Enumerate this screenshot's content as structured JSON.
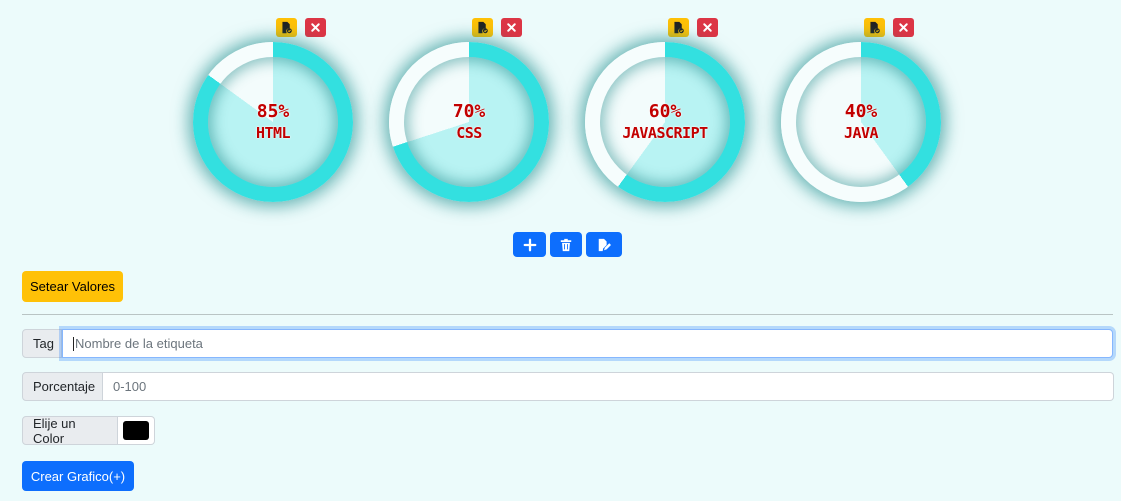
{
  "colors": {
    "ring_fill": "#33e0e0",
    "ring_empty": "#f6fdfd",
    "inner_fill": "#b8f3f3",
    "inner_empty": "#f3fcfc",
    "label_text": "#c20000"
  },
  "charts": [
    {
      "percent_label": "85%",
      "tag": "HTML",
      "value": 85
    },
    {
      "percent_label": "70%",
      "tag": "CSS",
      "value": 70
    },
    {
      "percent_label": "60%",
      "tag": "JAVASCRIPT",
      "value": 60
    },
    {
      "percent_label": "40%",
      "tag": "JAVA",
      "value": 40
    }
  ],
  "chart_icons": {
    "edit": "file-edit-icon",
    "delete": "close-icon"
  },
  "toolbar": {
    "add_icon": "plus-icon",
    "delete_icon": "trash-icon",
    "edit_icon": "file-edit-icon"
  },
  "set_values_label": "Setear Valores",
  "form": {
    "tag_label": "Tag",
    "tag_placeholder": "Nombre de la etiqueta",
    "percent_label": "Porcentaje",
    "percent_placeholder": "0-100",
    "color_label": "Elije un Color",
    "color_value": "#000000",
    "create_label": "Crear Grafico(+)"
  }
}
